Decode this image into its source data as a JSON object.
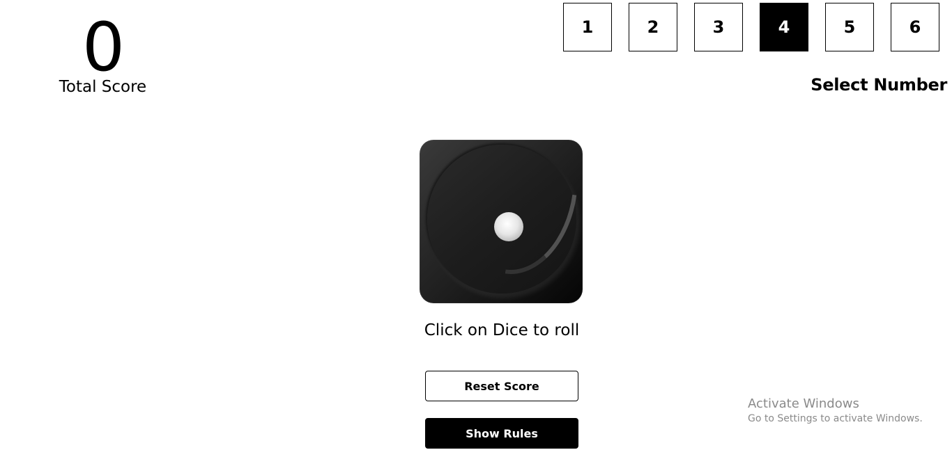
{
  "score": {
    "value": "0",
    "label": "Total Score"
  },
  "number_select": {
    "options": [
      "1",
      "2",
      "3",
      "4",
      "5",
      "6"
    ],
    "selected": "4",
    "label": "Select Number"
  },
  "dice": {
    "current_face": 1,
    "hint": "Click on Dice to roll"
  },
  "buttons": {
    "reset": "Reset Score",
    "rules": "Show Rules"
  },
  "watermark": {
    "title": "Activate Windows",
    "subtitle": "Go to Settings to activate Windows."
  }
}
